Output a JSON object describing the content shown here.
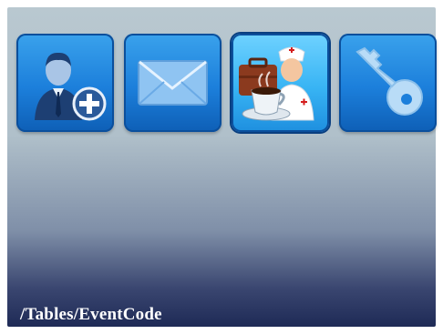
{
  "menu": {
    "items": [
      {
        "icon": "add-user-icon",
        "selected": false
      },
      {
        "icon": "message-envelope-icon",
        "selected": false
      },
      {
        "icon": "nurse-coffee-briefcase-icon",
        "selected": true
      },
      {
        "icon": "key-icon",
        "selected": false
      }
    ]
  },
  "status_bar": {
    "path": "/Tables/EventCode"
  },
  "colors": {
    "tile": "#1c7fdb",
    "tile_selected": "#38b4f4",
    "background_top": "#b9c8d0",
    "background_bottom": "#1e2a56"
  }
}
